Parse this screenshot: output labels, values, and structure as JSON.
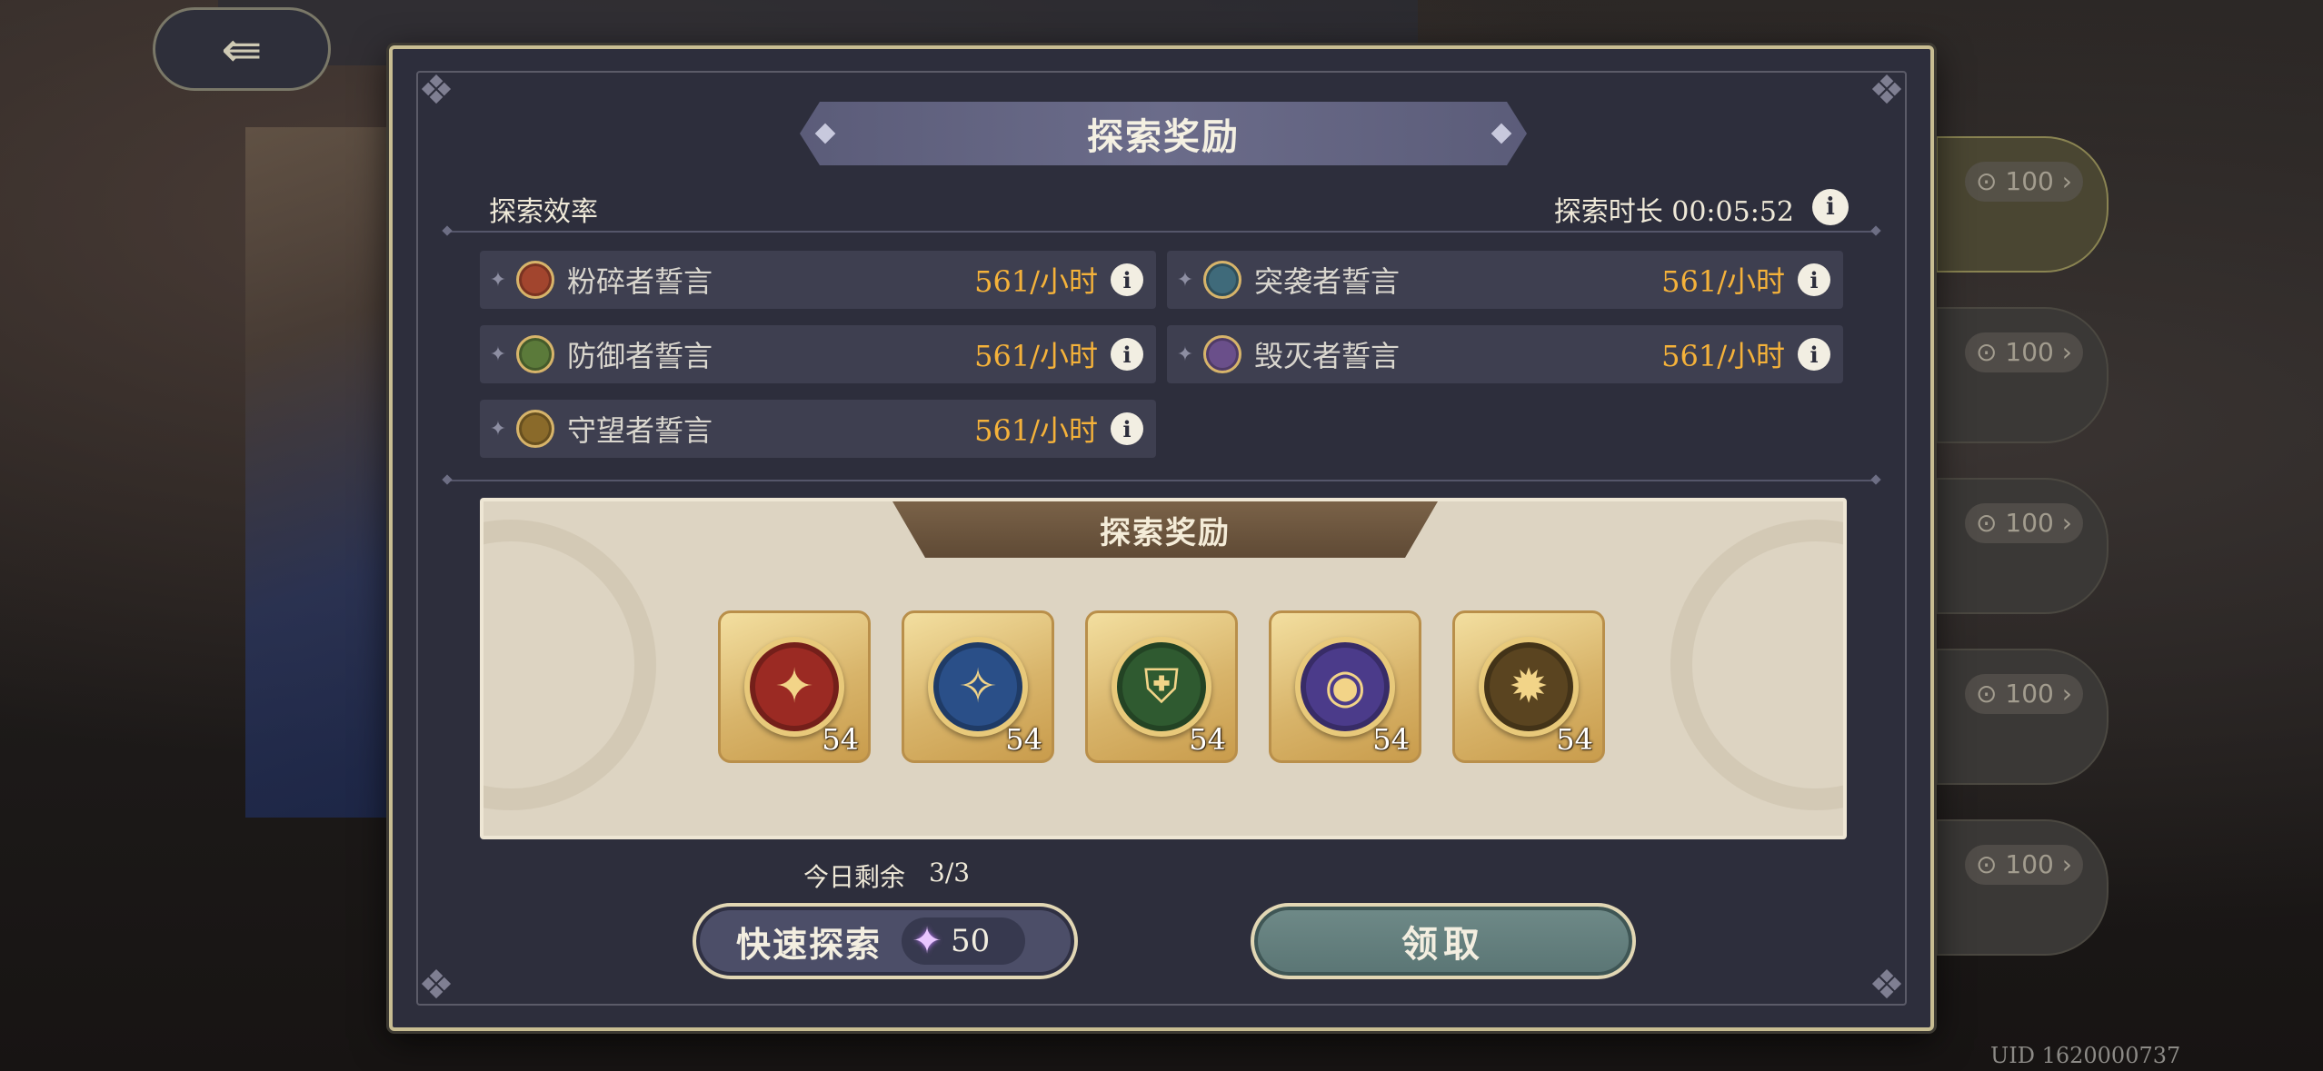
{
  "background": {
    "back_icon": "back-arrow-icon",
    "cards": [
      {
        "price": "100"
      },
      {
        "price": "100"
      },
      {
        "price": "100"
      },
      {
        "price": "100"
      },
      {
        "price": "100"
      }
    ],
    "uid": "UID 1620000737"
  },
  "dialog": {
    "title": "探索奖励",
    "efficiency_label": "探索效率",
    "duration_label": "探索时长 00:05:52",
    "rates": [
      {
        "name": "粉碎者誓言",
        "value": "561/小时",
        "medal_color": "#a2452e"
      },
      {
        "name": "突袭者誓言",
        "value": "561/小时",
        "medal_color": "#3f6a7a"
      },
      {
        "name": "防御者誓言",
        "value": "561/小时",
        "medal_color": "#5b7a3a"
      },
      {
        "name": "毁灭者誓言",
        "value": "561/小时",
        "medal_color": "#6a4f8a"
      },
      {
        "name": "守望者誓言",
        "value": "561/小时",
        "medal_color": "#8a6a2a"
      }
    ],
    "reward_title": "探索奖励",
    "rewards": [
      {
        "icon": "crusher-medal-icon",
        "color": "#9b2a23",
        "count": "54"
      },
      {
        "icon": "raider-medal-icon",
        "color": "#2a4f88",
        "count": "54"
      },
      {
        "icon": "defender-medal-icon",
        "color": "#2f5a30",
        "count": "54"
      },
      {
        "icon": "destroyer-medal-icon",
        "color": "#4b3b8a",
        "count": "54"
      },
      {
        "icon": "watcher-medal-icon",
        "color": "#5a4420",
        "count": "54"
      }
    ],
    "remaining_label": "今日剩余",
    "remaining_value": "3/3",
    "quick_explore_label": "快速探索",
    "quick_explore_cost": "50",
    "claim_label": "领取"
  }
}
